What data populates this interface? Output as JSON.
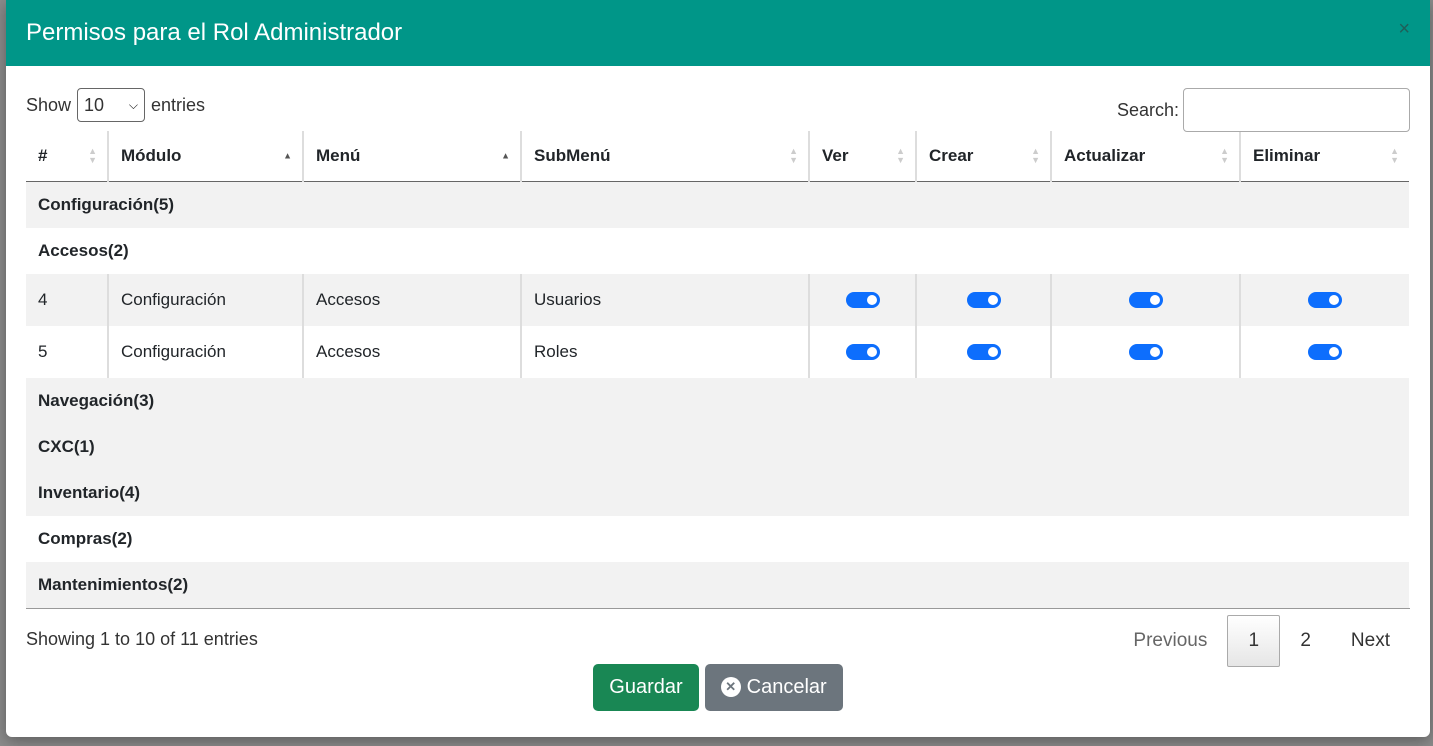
{
  "modal": {
    "title": "Permisos para el Rol Administrador",
    "close_icon": "×"
  },
  "length": {
    "prefix": "Show",
    "value": "10",
    "suffix": "entries"
  },
  "search": {
    "label": "Search:",
    "placeholder": ""
  },
  "columns": [
    "#",
    "Módulo",
    "Menú",
    "SubMenú",
    "Ver",
    "Crear",
    "Actualizar",
    "Eliminar"
  ],
  "groups": {
    "configuracion": "Configuración(5)",
    "accesos": "Accesos(2)",
    "navegacion": "Navegación(3)",
    "cxc": "CXC(1)",
    "inventario": "Inventario(4)",
    "compras": "Compras(2)",
    "mantenimientos": "Mantenimientos(2)"
  },
  "rows": [
    {
      "id": "4",
      "modulo": "Configuración",
      "menu": "Accesos",
      "submenu": "Usuarios",
      "ver": true,
      "crear": true,
      "actualizar": true,
      "eliminar": true
    },
    {
      "id": "5",
      "modulo": "Configuración",
      "menu": "Accesos",
      "submenu": "Roles",
      "ver": true,
      "crear": true,
      "actualizar": true,
      "eliminar": true
    }
  ],
  "info": "Showing 1 to 10 of 11 entries",
  "pagination": {
    "previous": "Previous",
    "page1": "1",
    "page2": "2",
    "next": "Next"
  },
  "buttons": {
    "save": "Guardar",
    "cancel": "Cancelar"
  },
  "colors": {
    "header": "#009688",
    "toggle": "#0d6efd",
    "save": "#198754",
    "cancel": "#6c757d"
  }
}
